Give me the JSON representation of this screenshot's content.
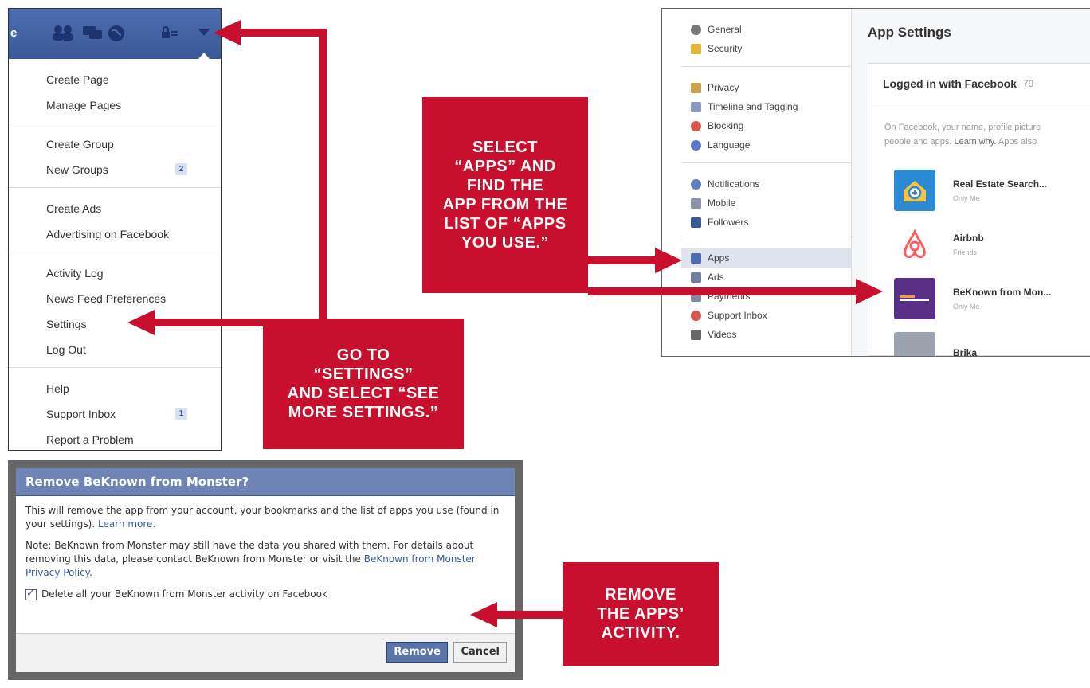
{
  "fb_menu": {
    "topbar_letter": "e",
    "groups": [
      {
        "items": [
          {
            "label": "Create Page"
          },
          {
            "label": "Manage Pages"
          }
        ]
      },
      {
        "items": [
          {
            "label": "Create Group"
          },
          {
            "label": "New Groups",
            "badge": "2"
          }
        ]
      },
      {
        "items": [
          {
            "label": "Create Ads"
          },
          {
            "label": "Advertising on Facebook"
          }
        ]
      },
      {
        "items": [
          {
            "label": "Activity Log"
          },
          {
            "label": "News Feed Preferences"
          },
          {
            "label": "Settings"
          },
          {
            "label": "Log Out"
          }
        ]
      },
      {
        "items": [
          {
            "label": "Help"
          },
          {
            "label": "Support Inbox",
            "badge": "1"
          },
          {
            "label": "Report a Problem"
          }
        ]
      }
    ]
  },
  "settings": {
    "nav_groups": [
      [
        {
          "label": "General",
          "icon": "gears-icon",
          "color": "#777777"
        },
        {
          "label": "Security",
          "icon": "security-badge-icon",
          "color": "#e2b53b"
        }
      ],
      [
        {
          "label": "Privacy",
          "icon": "privacy-lock-icon",
          "color": "#c9a24a"
        },
        {
          "label": "Timeline and Tagging",
          "icon": "timeline-icon",
          "color": "#8a9bbf"
        },
        {
          "label": "Blocking",
          "icon": "blocking-icon",
          "color": "#d9534f"
        },
        {
          "label": "Language",
          "icon": "globe-icon",
          "color": "#5b79c4"
        }
      ],
      [
        {
          "label": "Notifications",
          "icon": "notifications-globe-icon",
          "color": "#5f7fc0"
        },
        {
          "label": "Mobile",
          "icon": "mobile-icon",
          "color": "#8a93a8"
        },
        {
          "label": "Followers",
          "icon": "rss-icon",
          "color": "#3b5998"
        }
      ],
      [
        {
          "label": "Apps",
          "icon": "apps-icon",
          "color": "#4b6bb0",
          "active": true
        },
        {
          "label": "Ads",
          "icon": "ads-icon",
          "color": "#6f7fa3"
        },
        {
          "label": "Payments",
          "icon": "payments-card-icon",
          "color": "#7f8aa5"
        },
        {
          "label": "Support Inbox",
          "icon": "lifebuoy-icon",
          "color": "#d9534f"
        },
        {
          "label": "Videos",
          "icon": "film-icon",
          "color": "#666666"
        }
      ]
    ],
    "title": "App Settings",
    "logged_in_header": "Logged in with Facebook",
    "logged_in_count": "79",
    "desc_line1": "On Facebook, your name, profile picture",
    "desc_line2_prefix": "people and apps. ",
    "desc_line2_link": "Learn why.",
    "desc_line2_suffix": " Apps also",
    "apps": [
      {
        "name": "Real Estate Search...",
        "privacy": "Only Me",
        "thumb": "house-search-icon",
        "color": "#2a8ad4"
      },
      {
        "name": "Airbnb",
        "privacy": "Friends",
        "thumb": "airbnb-logo-icon",
        "color": "#ff5a5f"
      },
      {
        "name": "BeKnown from Mon...",
        "privacy": "Only Me",
        "thumb": "beknown-logo-icon",
        "color": "#5a2f86"
      },
      {
        "name": "Brika",
        "privacy": "",
        "thumb": "brika-logo-icon",
        "color": "#9aa3ad"
      }
    ]
  },
  "dialog": {
    "title": "Remove BeKnown from Monster?",
    "para1_text": "This will remove the app from your account, your bookmarks and the list of apps you use (found in your settings).",
    "para1_link": "Learn more.",
    "para2_text": "Note: BeKnown from Monster may still have the data you shared with them. For details about removing this data, please contact BeKnown from Monster or visit the",
    "para2_link": "BeKnown from Monster Privacy Policy",
    "para2_end": ".",
    "checkbox_label": "Delete all your BeKnown from Monster activity on Facebook",
    "checkbox_checked": true,
    "remove_label": "Remove",
    "cancel_label": "Cancel"
  },
  "callouts": {
    "select_apps": [
      "SELECT",
      "“APPS” AND",
      "FIND THE",
      "APP FROM THE",
      "LIST OF “APPS",
      "YOU USE.”"
    ],
    "go_to_settings": [
      "GO TO",
      "“SETTINGS”",
      "AND SELECT “SEE",
      "MORE SETTINGS.”"
    ],
    "remove_activity": [
      "REMOVE",
      "THE APPS’",
      "ACTIVITY."
    ]
  },
  "colors": {
    "callout_red": "#c8102e",
    "facebook_blue": "#3b5998"
  }
}
